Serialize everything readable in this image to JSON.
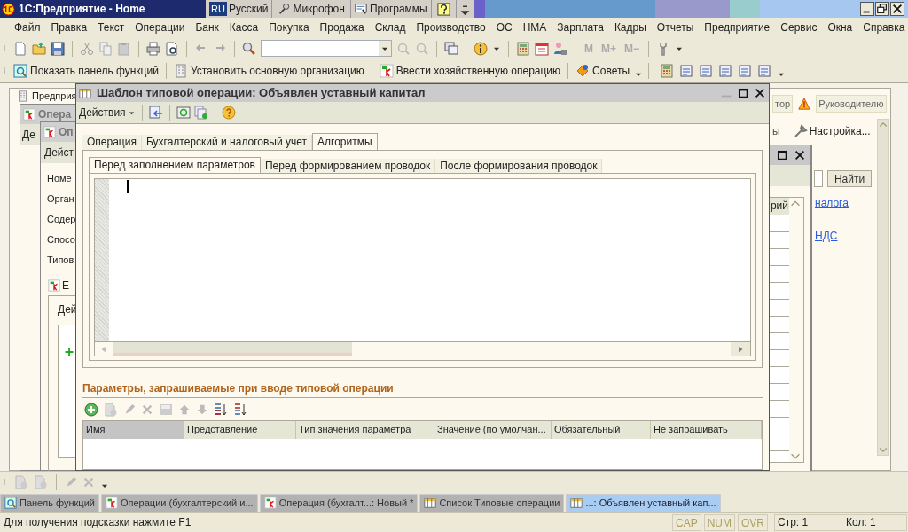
{
  "app_title": "1С:Предприятие - Home",
  "language_bar": [
    {
      "kind": "lang",
      "code": "RU",
      "label": "Русский"
    },
    {
      "kind": "mic",
      "label": "Микрофон"
    },
    {
      "kind": "programs",
      "label": "Программы"
    },
    {
      "kind": "help"
    },
    {
      "kind": "options"
    }
  ],
  "menu": [
    "Файл",
    "Правка",
    "Текст",
    "Операции",
    "Банк",
    "Касса",
    "Покупка",
    "Продажа",
    "Склад",
    "Производство",
    "ОС",
    "НМА",
    "Зарплата",
    "Кадры",
    "Отчеты",
    "Предприятие",
    "Сервис",
    "Окна",
    "Справка"
  ],
  "memory_buttons": [
    "M",
    "M+",
    "M−"
  ],
  "function_toolbar": [
    {
      "kind": "panel",
      "label": "Показать панель функций"
    },
    {
      "kind": "org",
      "label": "Установить основную организацию"
    },
    {
      "kind": "dtkt",
      "label": "Ввести хозяйственную операцию"
    },
    {
      "kind": "tips",
      "label": "Советы"
    }
  ],
  "function_panel": {
    "tabs": [
      {
        "label": "Предприя",
        "selected": true
      },
      {
        "label": "тор",
        "selected": false
      },
      {
        "label": "Руководителю",
        "selected": false
      }
    ],
    "toolbar_tail": "ы",
    "settings_button": "Настройка...",
    "find_button": "Найти",
    "links": [
      "налога",
      "НДС"
    ]
  },
  "operations_list_window": {
    "title": "Опера",
    "actions": "Де"
  },
  "operation_window": {
    "title": "Оп",
    "actions": "Дейст",
    "fields": [
      "Номе",
      "Орган",
      "Содер",
      "Спосо",
      "Типов"
    ],
    "entries_tab": "Е",
    "entries_actions": "Дей"
  },
  "list_window": {
    "column": "рий"
  },
  "main_window": {
    "title": "Шаблон типовой операции: Объявлен уставный капитал",
    "actions_menu": "Действия",
    "tabs": [
      {
        "label": "Операция",
        "selected": false
      },
      {
        "label": "Бухгалтерский и налоговый учет",
        "selected": false
      },
      {
        "label": "Алгоритмы",
        "selected": true
      }
    ],
    "subtabs": [
      {
        "label": "Перед заполнением параметров",
        "selected": true
      },
      {
        "label": "Перед формированием проводок",
        "selected": false
      },
      {
        "label": "После формирования проводок",
        "selected": false
      }
    ],
    "params_title": "Параметры, запрашиваемые при вводе типовой операции",
    "params_columns": [
      {
        "label": "Имя",
        "selected": true
      },
      {
        "label": "Представление",
        "selected": false
      },
      {
        "label": "Тип значения параметра",
        "selected": false
      },
      {
        "label": "Значение (по умолчан...",
        "selected": false
      },
      {
        "label": "Обязательный",
        "selected": false
      },
      {
        "label": "Не запрашивать",
        "selected": false
      }
    ]
  },
  "window_tabs": [
    {
      "kind": "panel",
      "label": "Панель функций",
      "selected": false
    },
    {
      "kind": "document",
      "label": "Операции (бухгалтерский и...",
      "selected": false
    },
    {
      "kind": "document",
      "label": "Операция (бухгалт...: Новый *",
      "selected": false
    },
    {
      "kind": "list",
      "label": "Список Типовые операции",
      "selected": false
    },
    {
      "kind": "list",
      "label": "...: Объявлен уставный кап...",
      "selected": true
    }
  ],
  "status_bar": {
    "hint": "Для получения подсказки нажмите F1",
    "indicators": [
      "CAP",
      "NUM",
      "OVR"
    ],
    "line": "Стр: 1",
    "column": "Кол: 1"
  }
}
